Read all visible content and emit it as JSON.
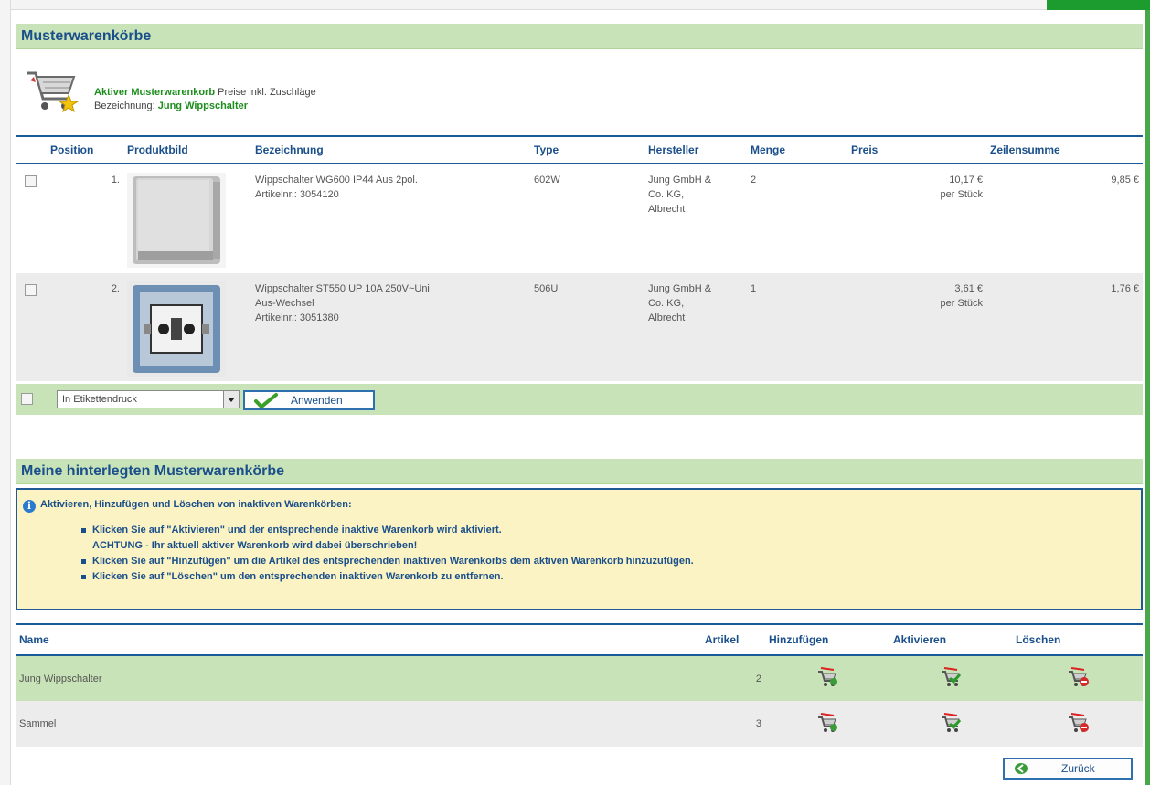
{
  "colors": {
    "section_bg": "#c8e3b7",
    "header_blue": "#1a4f8b",
    "accent_green": "#1c8d1c",
    "info_bg": "#fbf3c3"
  },
  "section1": {
    "title": "Musterwarenkörbe"
  },
  "active": {
    "label": "Aktiver Musterwarenkorb",
    "prices_note": "Preise inkl. Zuschläge",
    "name_label": "Bezeichnung:",
    "name_value": "Jung Wippschalter"
  },
  "cart_table": {
    "headers": {
      "position": "Position",
      "image": "Produktbild",
      "name": "Bezeichnung",
      "type": "Type",
      "maker": "Hersteller",
      "qty": "Menge",
      "price": "Preis",
      "sum": "Zeilensumme"
    },
    "rows": [
      {
        "position": "1.",
        "name_line1": "Wippschalter WG600 IP44 Aus 2pol.",
        "name_line2": "Artikelnr.: 3054120",
        "name_line3": "",
        "type": "602W",
        "maker_line1": "Jung GmbH &",
        "maker_line2": "Co. KG,",
        "maker_line3": "Albrecht",
        "qty": "2",
        "price": "10,17 €",
        "price_unit": "per Stück",
        "sum": "9,85 €"
      },
      {
        "position": "2.",
        "name_line1": "Wippschalter ST550 UP 10A 250V~Uni",
        "name_line2": "Aus-Wechsel",
        "name_line3": "Artikelnr.: 3051380",
        "type": "506U",
        "maker_line1": "Jung GmbH &",
        "maker_line2": "Co. KG,",
        "maker_line3": "Albrecht",
        "qty": "1",
        "price": "3,61 €",
        "price_unit": "per Stück",
        "sum": "1,76 €"
      }
    ]
  },
  "actions": {
    "select_value": "In Etikettendruck",
    "apply_label": "Anwenden"
  },
  "section2": {
    "title": "Meine hinterlegten Musterwarenkörbe"
  },
  "info": {
    "icon": "info-icon",
    "title": "Aktivieren, Hinzufügen und Löschen von inaktiven Warenkörben:",
    "items": [
      "Klicken Sie auf \"Aktivieren\" und der entsprechende inaktive Warenkorb wird aktiviert.",
      "ACHTUNG - Ihr aktuell aktiver Warenkorb wird dabei überschrieben!",
      "Klicken Sie auf \"Hinzufügen\" um die Artikel des entsprechenden inaktiven Warenkorbs dem aktiven Warenkorb hinzuzufügen.",
      "Klicken Sie auf \"Löschen\" um den entsprechenden inaktiven Warenkorb zu entfernen."
    ]
  },
  "saved_table": {
    "headers": {
      "name": "Name",
      "count": "Artikel",
      "add": "Hinzufügen",
      "activate": "Aktivieren",
      "delete": "Löschen"
    },
    "rows": [
      {
        "name": "Jung Wippschalter",
        "count": "2"
      },
      {
        "name": "Sammel",
        "count": "3"
      }
    ]
  },
  "back": {
    "label": "Zurück"
  }
}
